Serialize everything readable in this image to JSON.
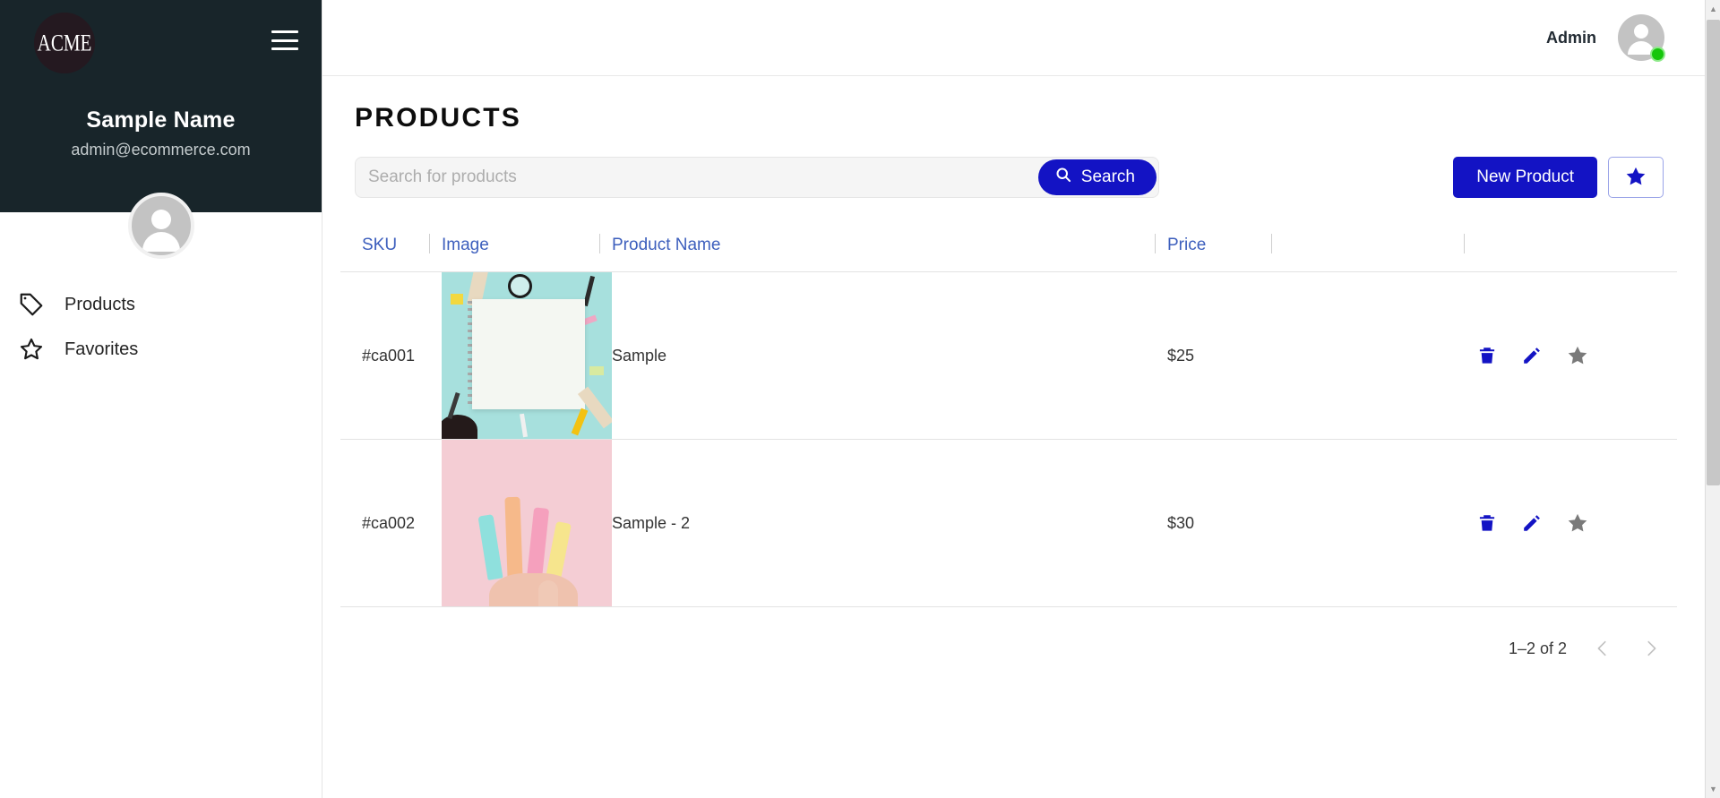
{
  "sidebar": {
    "logo_text": "ACME",
    "menu_icon": "hamburger-icon",
    "user_name": "Sample Name",
    "user_email": "admin@ecommerce.com",
    "nav_items": [
      {
        "label": "Products",
        "icon": "tag-icon"
      },
      {
        "label": "Favorites",
        "icon": "star-outline-icon"
      }
    ]
  },
  "topbar": {
    "user_role": "Admin",
    "avatar_icon": "user-avatar-icon",
    "status": "online",
    "status_color": "#16c60c"
  },
  "page": {
    "title": "PRODUCTS"
  },
  "search": {
    "placeholder": "Search for products",
    "value": "",
    "button_label": "Search",
    "button_icon": "search-icon"
  },
  "toolbar": {
    "new_product_label": "New Product",
    "favorites_icon": "star-filled-icon",
    "accent_color": "#1313c4"
  },
  "table": {
    "columns": [
      "SKU",
      "Image",
      "Product Name",
      "Price",
      "",
      ""
    ],
    "rows": [
      {
        "sku": "#ca001",
        "image_alt": "mint-flatlay-notebook",
        "name": "Sample",
        "price": "$25",
        "actions": [
          "delete-icon",
          "edit-icon",
          "favorite-icon"
        ],
        "favorite_color": "#7a7a7a"
      },
      {
        "sku": "#ca002",
        "image_alt": "pink-pastel-highlighters",
        "name": "Sample - 2",
        "price": "$30",
        "actions": [
          "delete-icon",
          "edit-icon",
          "favorite-icon"
        ],
        "favorite_color": "#7a7a7a"
      }
    ]
  },
  "pagination": {
    "range_label": "1–2 of 2",
    "prev_icon": "chevron-left-icon",
    "next_icon": "chevron-right-icon"
  }
}
